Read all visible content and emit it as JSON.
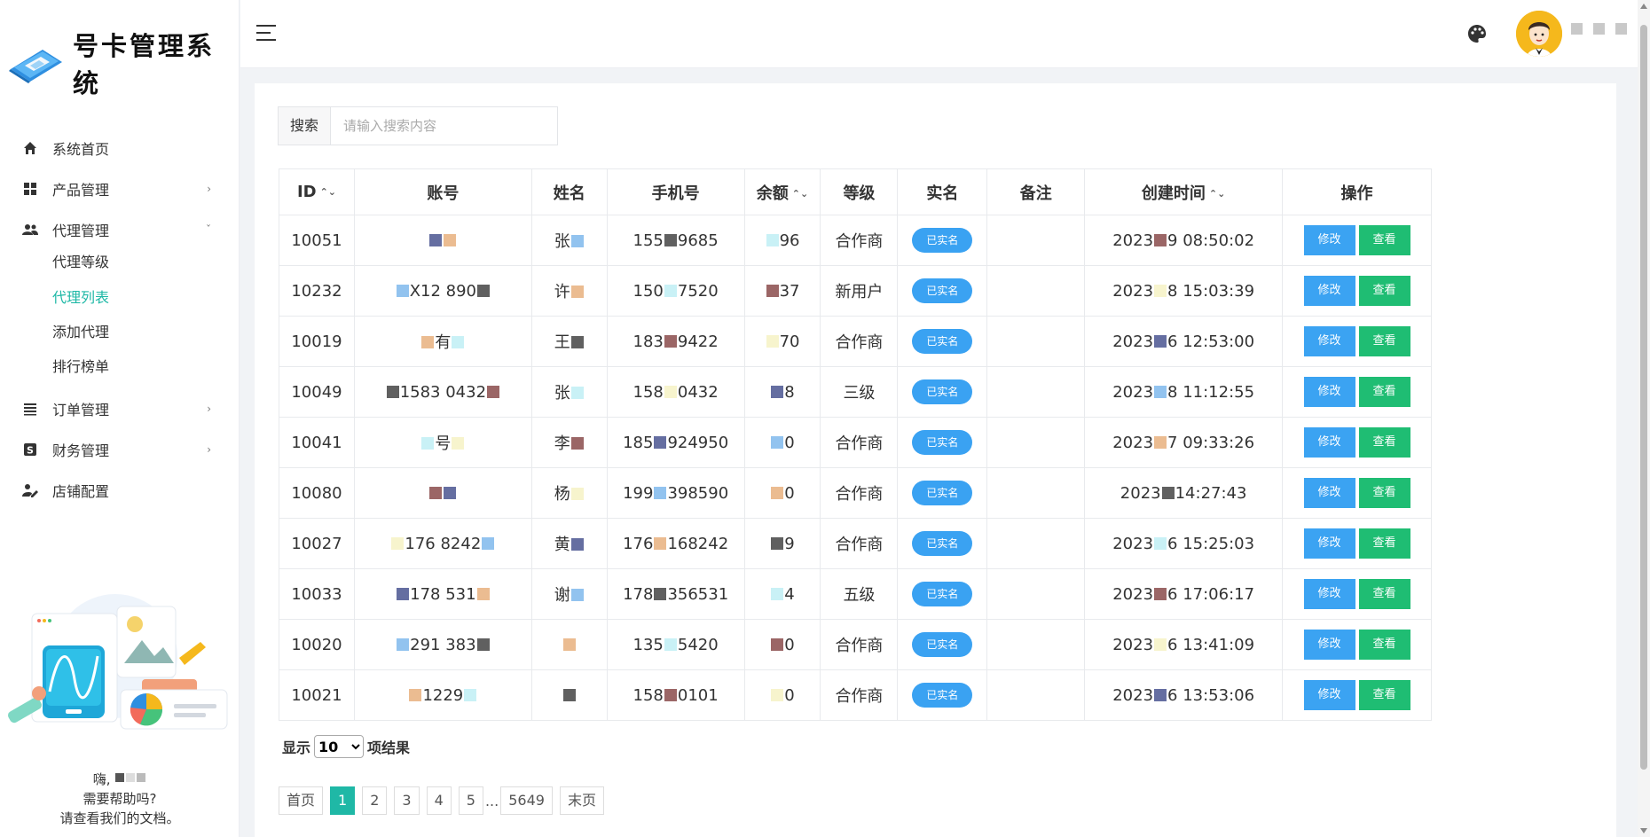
{
  "app": {
    "title": "号卡管理系统"
  },
  "sidebar": {
    "items": [
      {
        "label": "系统首页",
        "icon": "home-icon",
        "chevron": ""
      },
      {
        "label": "产品管理",
        "icon": "grid-icon",
        "chevron": "›"
      },
      {
        "label": "代理管理",
        "icon": "users-icon",
        "chevron": "ˇ"
      },
      {
        "label": "订单管理",
        "icon": "list-icon",
        "chevron": "›"
      },
      {
        "label": "财务管理",
        "icon": "dollar-icon",
        "chevron": "›"
      },
      {
        "label": "店铺配置",
        "icon": "user-edit-icon",
        "chevron": ""
      }
    ],
    "subitems": [
      {
        "label": "代理等级",
        "active": false
      },
      {
        "label": "代理列表",
        "active": true
      },
      {
        "label": "添加代理",
        "active": false
      },
      {
        "label": "排行榜单",
        "active": false
      }
    ],
    "help": {
      "greeting": "嗨,",
      "question": "需要帮助吗?",
      "hint": "请查看我们的文档。"
    }
  },
  "search": {
    "label": "搜索",
    "placeholder": "请输入搜索内容"
  },
  "table": {
    "headers": {
      "id": "ID",
      "account": "账号",
      "name": "姓名",
      "phone": "手机号",
      "balance": "余额",
      "level": "等级",
      "realname": "实名",
      "note": "备注",
      "created": "创建时间",
      "action": "操作"
    },
    "rows": [
      {
        "id": "10051",
        "account": "",
        "name": "张",
        "phone_a": "155",
        "phone_b": "9685",
        "balance": "96",
        "level": "合作商",
        "realname": "已实名",
        "note": "",
        "date_a": "2023",
        "date_b": "9 08:50:02"
      },
      {
        "id": "10232",
        "account": "X12  890",
        "name": "许",
        "phone_a": "150",
        "phone_b": "7520",
        "balance": "37",
        "level": "新用户",
        "realname": "已实名",
        "note": "",
        "date_a": "2023",
        "date_b": "8 15:03:39"
      },
      {
        "id": "10019",
        "account": "有",
        "name": "王",
        "phone_a": "183",
        "phone_b": "9422",
        "balance": "70",
        "level": "合作商",
        "realname": "已实名",
        "note": "",
        "date_a": "2023",
        "date_b": "6 12:53:00"
      },
      {
        "id": "10049",
        "account": "1583  0432",
        "name": "张",
        "phone_a": "158",
        "phone_b": "0432",
        "balance": "8",
        "level": "三级",
        "realname": "已实名",
        "note": "",
        "date_a": "2023",
        "date_b": "8 11:12:55"
      },
      {
        "id": "10041",
        "account": "号",
        "name": "李",
        "phone_a": "185",
        "phone_b": "924950",
        "balance": "0",
        "level": "合作商",
        "realname": "已实名",
        "note": "",
        "date_a": "2023",
        "date_b": "7 09:33:26"
      },
      {
        "id": "10080",
        "account": "",
        "name": "杨",
        "phone_a": "199",
        "phone_b": "398590",
        "balance": "0",
        "level": "合作商",
        "realname": "已实名",
        "note": "",
        "date_a": "2023",
        "date_b": "14:27:43"
      },
      {
        "id": "10027",
        "account": "176  8242",
        "name": "黄",
        "phone_a": "176",
        "phone_b": "168242",
        "balance": "9",
        "level": "合作商",
        "realname": "已实名",
        "note": "",
        "date_a": "2023",
        "date_b": "6 15:25:03"
      },
      {
        "id": "10033",
        "account": "178  531",
        "name": "谢",
        "phone_a": "178",
        "phone_b": "356531",
        "balance": "4",
        "level": "五级",
        "realname": "已实名",
        "note": "",
        "date_a": "2023",
        "date_b": "6 17:06:17"
      },
      {
        "id": "10020",
        "account": "291  383",
        "name": "",
        "phone_a": "135",
        "phone_b": "5420",
        "balance": "0",
        "level": "合作商",
        "realname": "已实名",
        "note": "",
        "date_a": "2023",
        "date_b": "6 13:41:09"
      },
      {
        "id": "10021",
        "account": "1229",
        "name": "",
        "phone_a": "158",
        "phone_b": "0101",
        "balance": "0",
        "level": "合作商",
        "realname": "已实名",
        "note": "",
        "date_a": "2023",
        "date_b": "6 13:53:06"
      }
    ],
    "edit_label": "修改",
    "view_label": "查看"
  },
  "pagesize": {
    "prefix": "显示",
    "value": "10",
    "suffix": "项结果"
  },
  "pager": {
    "first": "首页",
    "pages": [
      "1",
      "2",
      "3",
      "4",
      "5"
    ],
    "ellipsis": "...",
    "last_page": "5649",
    "last": "末页",
    "active": "1"
  },
  "colors": {
    "accent": "#1fb8a6",
    "badge": "#3aa2f2",
    "edit": "#3ba3f2",
    "view": "#1fbd73"
  }
}
